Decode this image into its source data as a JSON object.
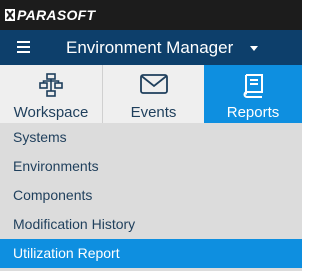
{
  "brand": {
    "logo_text": "PARASOFT"
  },
  "header": {
    "title": "Environment Manager"
  },
  "tabs": [
    {
      "label": "Workspace",
      "icon": "workspace-tree-icon"
    },
    {
      "label": "Events",
      "icon": "envelope-icon"
    },
    {
      "label": "Reports",
      "icon": "book-icon",
      "selected": true
    }
  ],
  "reports": {
    "items": [
      {
        "label": "Systems"
      },
      {
        "label": "Environments"
      },
      {
        "label": "Components"
      },
      {
        "label": "Modification History"
      },
      {
        "label": "Utilization Report",
        "selected": true
      }
    ]
  },
  "colors": {
    "header_bg": "#0d3f6b",
    "accent": "#0e8fe0",
    "logo_bar_bg": "#1c1c1c",
    "text": "#1f3f5c"
  }
}
